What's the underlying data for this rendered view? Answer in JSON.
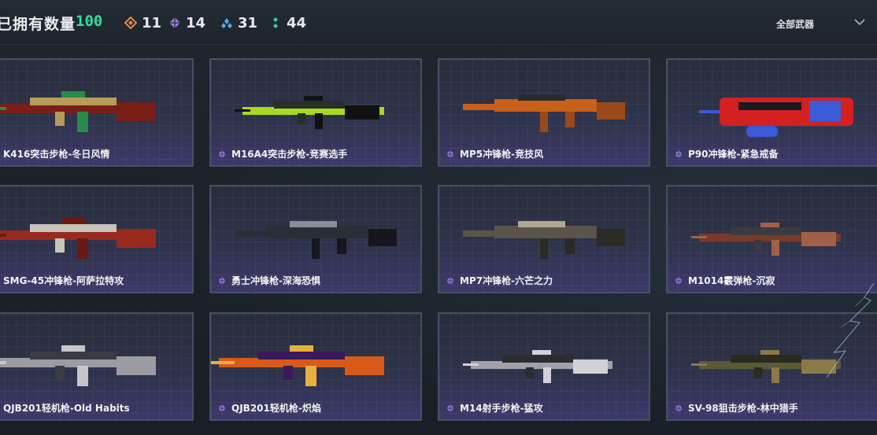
{
  "header": {
    "owned_label": "已拥有数量",
    "owned_count": "100",
    "stats": [
      {
        "icon": "orange-diamond-icon",
        "color": "#e08a4a",
        "value": "11"
      },
      {
        "icon": "purple-diamond-icon",
        "color": "#9a7ae8",
        "value": "14"
      },
      {
        "icon": "blue-diamond-icon",
        "color": "#5aa8e8",
        "value": "31"
      },
      {
        "icon": "green-dots-icon",
        "color": "#35d49a",
        "value": "44"
      }
    ],
    "filter_label": "全部武器"
  },
  "weapons": [
    {
      "name": "K416突击步枪-冬日风情",
      "rarity": "orange",
      "palette": [
        "#7a1f18",
        "#b89a5a",
        "#2a8a4a"
      ]
    },
    {
      "name": "M16A4突击步枪-竞赛选手",
      "rarity": "purple",
      "palette": [
        "#a8d820",
        "#2a2e2a",
        "#111"
      ]
    },
    {
      "name": "MP5冲锋枪-竞技风",
      "rarity": "purple",
      "palette": [
        "#c8601a",
        "#2a2a2e",
        "#9a4a1a"
      ]
    },
    {
      "name": "P90冲锋枪-紧急戒备",
      "rarity": "purple",
      "palette": [
        "#d42020",
        "#1a1a22",
        "#3a5ad8"
      ]
    },
    {
      "name": "SMG-45冲锋枪-阿萨拉特攻",
      "rarity": "orange",
      "palette": [
        "#9a2a20",
        "#c8c4bc",
        "#6a1a14"
      ]
    },
    {
      "name": "勇士冲锋枪-深海恐惧",
      "rarity": "purple",
      "palette": [
        "#2a2e36",
        "#8a8e96",
        "#15171c"
      ]
    },
    {
      "name": "MP7冲锋枪-六芒之力",
      "rarity": "purple",
      "palette": [
        "#5a544a",
        "#b0a890",
        "#2a2a26"
      ]
    },
    {
      "name": "M1014霰弹枪-沉寂",
      "rarity": "purple",
      "palette": [
        "#7a3a2a",
        "#3a3a40",
        "#a0604a"
      ]
    },
    {
      "name": "QJB201轻机枪-Old Habits",
      "rarity": "orange",
      "palette": [
        "#9a9ca2",
        "#3a3c42",
        "#c4c6cc"
      ]
    },
    {
      "name": "QJB201轻机枪-炽焰",
      "rarity": "purple",
      "palette": [
        "#d85a1a",
        "#3a1a5a",
        "#e8b040"
      ]
    },
    {
      "name": "M14射手步枪-猛攻",
      "rarity": "purple",
      "palette": [
        "#a0a2a8",
        "#2a2c30",
        "#d0d2d6"
      ]
    },
    {
      "name": "SV-98狙击步枪-林中猎手",
      "rarity": "purple",
      "palette": [
        "#5a5a36",
        "#2a2a20",
        "#8a7a4a"
      ]
    }
  ]
}
